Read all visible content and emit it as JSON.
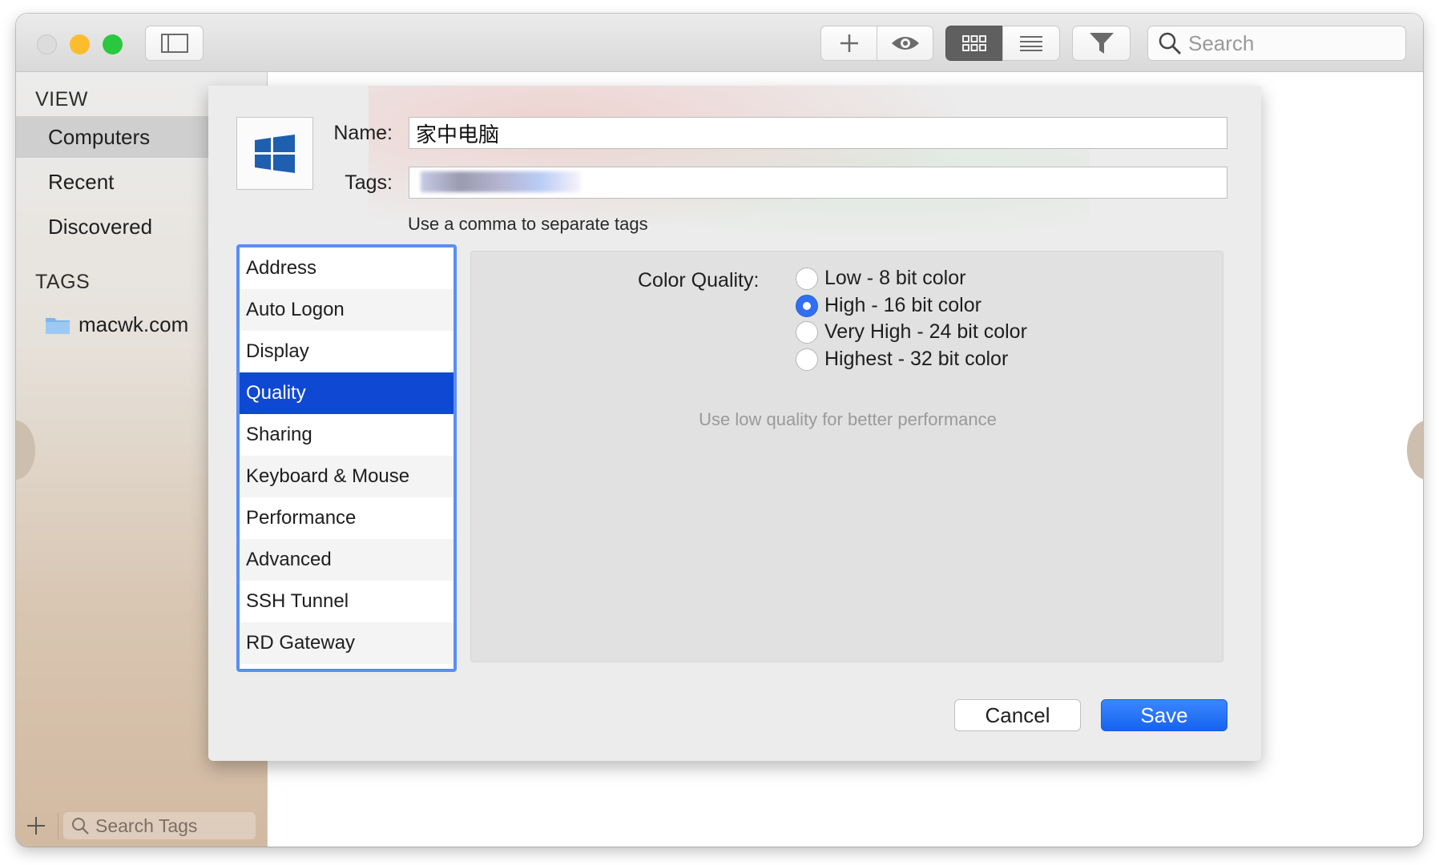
{
  "toolbar": {
    "search_placeholder": "Search",
    "icons": [
      "sidebar-toggle-icon",
      "plus-icon",
      "eye-icon",
      "grid-view-icon",
      "list-view-icon",
      "filter-icon",
      "search-icon"
    ]
  },
  "sidebar": {
    "view_heading": "VIEW",
    "items": [
      {
        "label": "Computers",
        "selected": true
      },
      {
        "label": "Recent",
        "selected": false
      },
      {
        "label": "Discovered",
        "selected": false
      }
    ],
    "tags_heading": "TAGS",
    "tag_item": "macwk.com",
    "search_tags_placeholder": "Search Tags"
  },
  "dialog": {
    "name_label": "Name:",
    "name_value": "家中电脑",
    "tags_label": "Tags:",
    "tags_hint": "Use a comma to separate tags",
    "categories": [
      "Address",
      "Auto Logon",
      "Display",
      "Quality",
      "Sharing",
      "Keyboard & Mouse",
      "Performance",
      "Advanced",
      "SSH Tunnel",
      "RD Gateway"
    ],
    "selected_category": "Quality",
    "quality": {
      "color_quality_label": "Color Quality:",
      "options": [
        {
          "label": "Low - 8 bit color",
          "selected": false
        },
        {
          "label": "High - 16 bit color",
          "selected": true
        },
        {
          "label": "Very High - 24 bit color",
          "selected": false
        },
        {
          "label": "Highest - 32 bit color",
          "selected": false
        }
      ],
      "hint": "Use low quality for better performance"
    },
    "cancel_label": "Cancel",
    "save_label": "Save"
  },
  "colors": {
    "accent": "#2f6ff5",
    "selection": "#0f48d2",
    "list_focus_ring": "#5a8ef7"
  }
}
